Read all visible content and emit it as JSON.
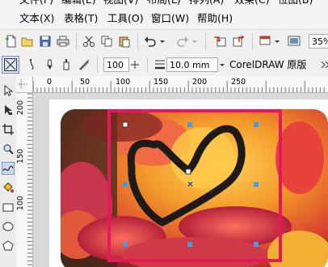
{
  "menubar": {
    "top_row": [
      "文件(F)",
      "编辑(E)",
      "视图(V)",
      "布局(L)",
      "排列(A)",
      "效果(C)",
      "位图(B)"
    ],
    "items": [
      "文本(X)",
      "表格(T)",
      "工具(O)",
      "窗口(W)",
      "帮助(H)"
    ]
  },
  "toolbar": {
    "zoom_value": "35%",
    "icons": [
      "new-icon",
      "open-icon",
      "save-icon",
      "print-icon",
      "cut-icon",
      "copy-icon",
      "paste-icon",
      "undo-icon",
      "redo-icon",
      "import-icon",
      "export-icon",
      "application-launcher-icon",
      "welcome-screen-icon"
    ]
  },
  "property_bar": {
    "smoothing_value": "100",
    "outline_width": "10.0 mm",
    "style_label": "CorelDRAW 原版"
  },
  "rulers": {
    "horizontal_labels": [
      "0",
      "50",
      "100",
      "150",
      "200",
      "250"
    ],
    "vertical_labels": [
      "200",
      "150",
      "100"
    ]
  },
  "toolbox": {
    "tools": [
      "pick-tool-icon",
      "shape-tool-icon",
      "crop-tool-icon",
      "zoom-tool-icon",
      "freehand-tool-icon",
      "smart-fill-tool-icon",
      "rectangle-tool-icon",
      "ellipse-tool-icon",
      "polygon-tool-icon"
    ]
  },
  "canvas": {
    "selection_color": "#e8175d",
    "photo_description": ""
  }
}
